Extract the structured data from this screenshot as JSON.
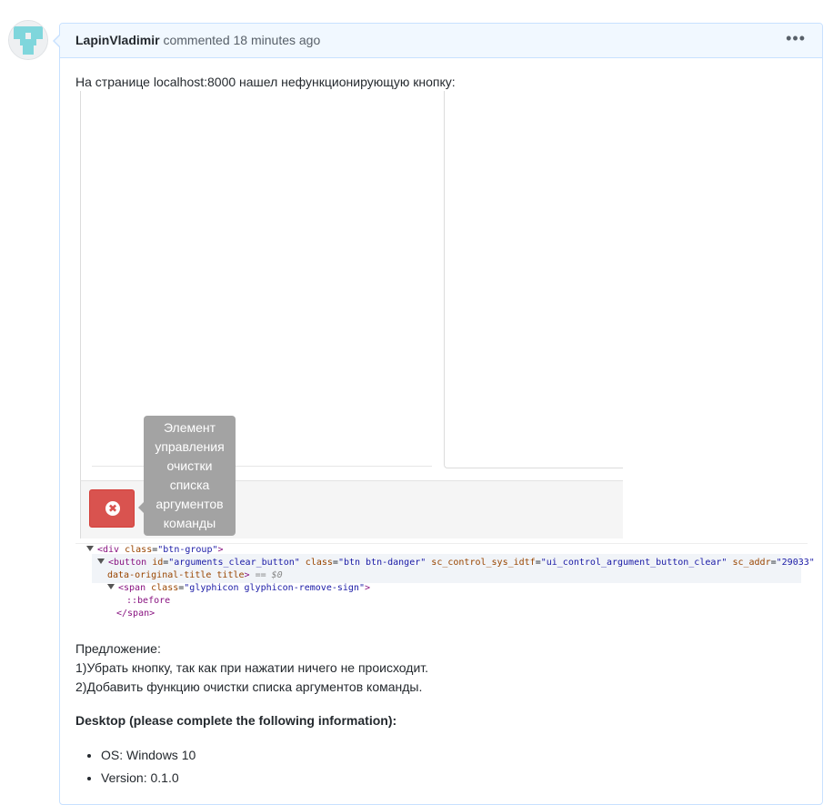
{
  "comment": {
    "author": "LapinVladimir",
    "action": "commented",
    "time": "18 minutes ago",
    "more_label": "•••",
    "intro": "На странице localhost:8000 нашел нефункционирующую кнопку:"
  },
  "screenshot": {
    "tooltip_lines": [
      "Элемент",
      "управления",
      "очистки",
      "списка",
      "аргументов",
      "команды"
    ],
    "button_icon": "remove-sign-icon",
    "button_color": "#d9534f",
    "tooltip_color": "#a3a3a3"
  },
  "devtools": {
    "line1_tag": "<div",
    "line1_attr": "class",
    "line1_val": "\"btn-group\"",
    "line2_tag": "<button",
    "line2_attr1": "id",
    "line2_val1": "\"arguments_clear_button\"",
    "line2_attr2": "class",
    "line2_val2": "\"btn btn-danger\"",
    "line2_attr3": "sc_control_sys_idtf",
    "line2_val3": "\"ui_control_argument_button_clear\"",
    "line2_attr4": "sc_addr",
    "line2_val4": "\"29033\"",
    "line3_attr": "data-original-title title",
    "line3_eq": "== $0",
    "line4_tag": "<span",
    "line4_attr": "class",
    "line4_val": "\"glyphicon glyphicon-remove-sign\"",
    "line5": "::before",
    "line6": "</span>"
  },
  "proposal": {
    "heading": "Предложение:",
    "item1": "1)Убрать кнопку, так как при нажатии ничего не происходит.",
    "item2": "2)Добавить функцию очистки списка аргументов команды."
  },
  "desktop": {
    "heading": "Desktop (please complete the following information):",
    "items": [
      "OS: Windows 10",
      "Version: 0.1.0"
    ]
  },
  "colors": {
    "header_bg": "#f1f8ff",
    "header_border": "#c8e1ff",
    "avatar_accent": "#7fd6dc"
  }
}
